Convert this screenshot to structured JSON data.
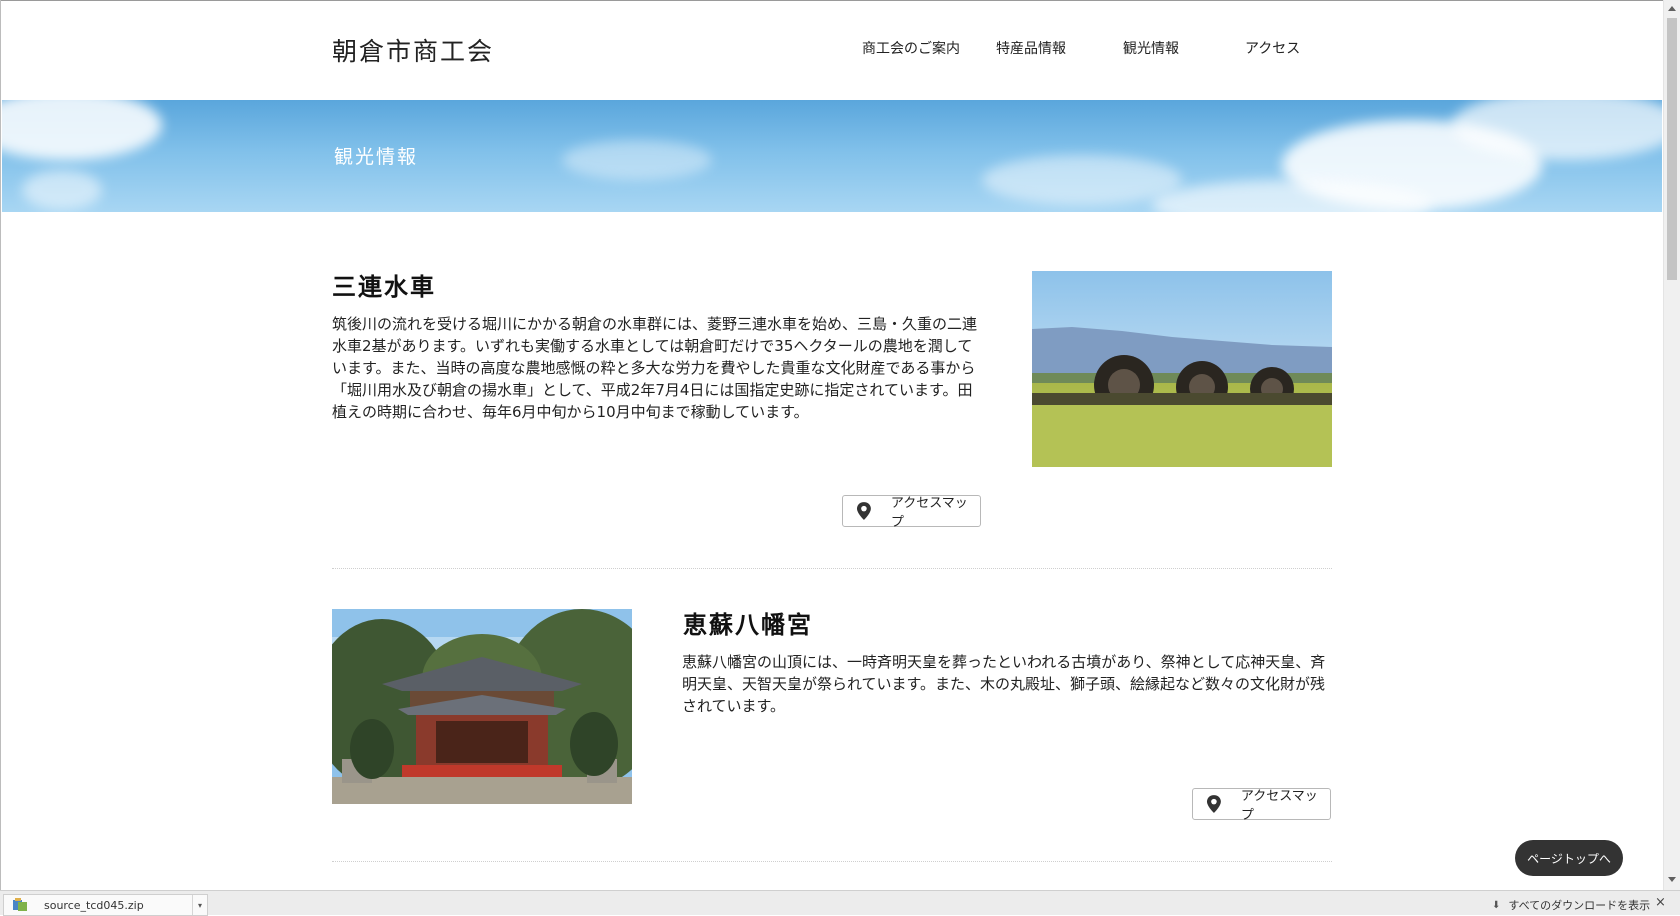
{
  "header": {
    "site_title": "朝倉市商工会",
    "nav": [
      "商工会のご案内",
      "特産品情報",
      "観光情報",
      "アクセス"
    ]
  },
  "hero": {
    "title": "観光情報"
  },
  "spots": [
    {
      "title": "三連水車",
      "description": "筑後川の流れを受ける堀川にかかる朝倉の水車群には、菱野三連水車を始め、三島・久重の二連水車2基があります。いずれも実働する水車としては朝倉町だけで35ヘクタールの農地を潤しています。また、当時の高度な農地感慨の粋と多大な労力を費やした貴重な文化財産である事から「堀川用水及び朝倉の揚水車」として、平成2年7月4日には国指定史跡に指定されています。田植えの時期に合わせ、毎年6月中旬から10月中旬まで稼動しています。",
      "map_button": "アクセスマップ"
    },
    {
      "title": "恵蘇八幡宮",
      "description": "恵蘇八幡宮の山頂には、一時斉明天皇を葬ったといわれる古墳があり、祭神として応神天皇、斉明天皇、天智天皇が祭られています。また、木の丸殿址、獅子頭、絵縁起など数々の文化財が残されています。",
      "map_button": "アクセスマップ"
    }
  ],
  "page_top": "ページトップへ",
  "download_bar": {
    "file_name": "source_tcd045.zip",
    "show_all": "すべてのダウンロードを表示",
    "close": "×"
  },
  "colors": {
    "sky": "#80c0ea",
    "page_top_bg": "#333333",
    "shrine_red": "#c0392b"
  },
  "icons": [
    "map-pin-icon",
    "download-file-icon",
    "down-arrow-icon",
    "close-icon"
  ]
}
